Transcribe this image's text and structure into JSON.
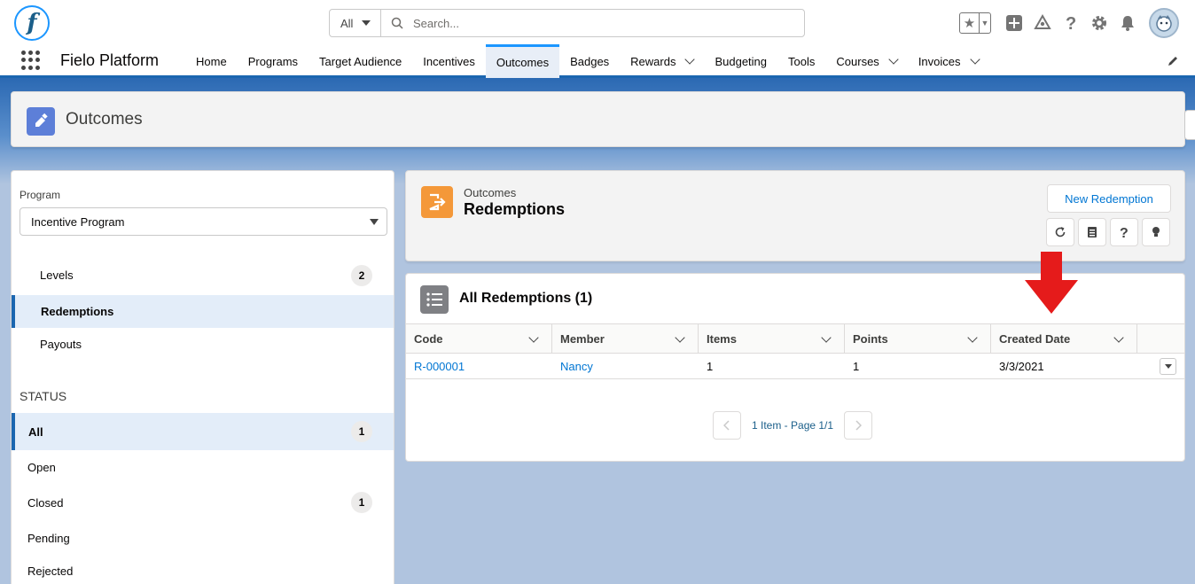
{
  "header": {
    "logo_letter": "f",
    "search_scope": "All",
    "search_placeholder": "Search..."
  },
  "nav": {
    "app_name": "Fielo Platform",
    "items": [
      {
        "label": "Home",
        "active": false,
        "dropdown": false
      },
      {
        "label": "Programs",
        "active": false,
        "dropdown": false
      },
      {
        "label": "Target Audience",
        "active": false,
        "dropdown": false
      },
      {
        "label": "Incentives",
        "active": false,
        "dropdown": false
      },
      {
        "label": "Outcomes",
        "active": true,
        "dropdown": false
      },
      {
        "label": "Badges",
        "active": false,
        "dropdown": false
      },
      {
        "label": "Rewards",
        "active": false,
        "dropdown": true
      },
      {
        "label": "Budgeting",
        "active": false,
        "dropdown": false
      },
      {
        "label": "Tools",
        "active": false,
        "dropdown": false
      },
      {
        "label": "Courses",
        "active": false,
        "dropdown": true
      },
      {
        "label": "Invoices",
        "active": false,
        "dropdown": true
      }
    ]
  },
  "page_header": {
    "title": "Outcomes"
  },
  "left_panel": {
    "program_label": "Program",
    "program_value": "Incentive Program",
    "outcome_items": [
      {
        "label": "Levels",
        "count": "2",
        "selected": false
      },
      {
        "label": "Redemptions",
        "count": "",
        "selected": true
      },
      {
        "label": "Payouts",
        "count": "",
        "selected": false
      }
    ],
    "status_heading": "STATUS",
    "status_items": [
      {
        "label": "All",
        "count": "1",
        "selected": true
      },
      {
        "label": "Open",
        "count": "",
        "selected": false
      },
      {
        "label": "Closed",
        "count": "1",
        "selected": false
      },
      {
        "label": "Pending",
        "count": "",
        "selected": false
      },
      {
        "label": "Rejected",
        "count": "",
        "selected": false
      }
    ]
  },
  "record_header": {
    "subtitle": "Outcomes",
    "title": "Redemptions",
    "new_button": "New Redemption"
  },
  "list": {
    "title": "All Redemptions (1)",
    "columns": [
      "Code",
      "Member",
      "Items",
      "Points",
      "Created Date"
    ],
    "rows": [
      {
        "code": "R-000001",
        "member": "Nancy",
        "items": "1",
        "points": "1",
        "created_date": "3/3/2021"
      }
    ],
    "pager_text": "1 Item - Page 1/1"
  },
  "colors": {
    "brand_blue": "#1b66b0",
    "link": "#0176d3",
    "annotation_arrow": "#e51b1b",
    "outcomes_icon": "#5d7fd8",
    "redemptions_icon": "#f49839"
  }
}
